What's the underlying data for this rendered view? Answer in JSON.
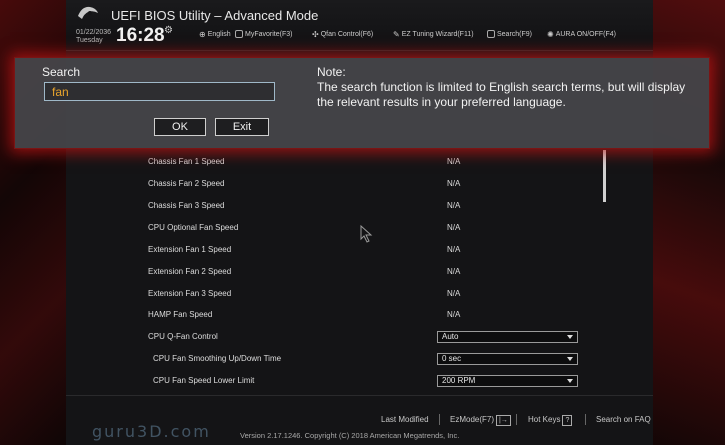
{
  "header": {
    "title": "UEFI BIOS Utility – Advanced Mode",
    "date": "01/22/2036",
    "day": "Tuesday",
    "time": "16:28",
    "items": [
      {
        "label": "English",
        "icon": "globe-icon"
      },
      {
        "label": "MyFavorite(F3)",
        "icon": "favorite-icon"
      },
      {
        "label": "Qfan Control(F6)",
        "icon": "fan-icon"
      },
      {
        "label": "EZ Tuning Wizard(F11)",
        "icon": "wizard-icon"
      },
      {
        "label": "Search(F9)",
        "icon": "help-icon"
      },
      {
        "label": "AURA ON/OFF(F4)",
        "icon": "aura-icon"
      }
    ]
  },
  "settings": [
    {
      "label": "Chassis Fan 1 Speed",
      "value": "N/A"
    },
    {
      "label": "Chassis Fan 2 Speed",
      "value": "N/A"
    },
    {
      "label": "Chassis Fan 3 Speed",
      "value": "N/A"
    },
    {
      "label": "CPU Optional Fan Speed",
      "value": "N/A"
    },
    {
      "label": "Extension Fan 1 Speed",
      "value": "N/A"
    },
    {
      "label": "Extension Fan 2 Speed",
      "value": "N/A"
    },
    {
      "label": "Extension Fan 3 Speed",
      "value": "N/A"
    },
    {
      "label": "HAMP Fan Speed",
      "value": "N/A"
    },
    {
      "label": "CPU Q-Fan Control",
      "select": "Auto"
    },
    {
      "label": "CPU Fan Smoothing Up/Down Time",
      "select": "0 sec"
    },
    {
      "label": "CPU Fan Speed Lower Limit",
      "select": "200 RPM"
    }
  ],
  "search_dialog": {
    "label": "Search",
    "query": "fan",
    "ok_label": "OK",
    "exit_label": "Exit",
    "note_title": "Note:",
    "note_text": "The search function is limited to English search terms, but will display the relevant results in your preferred language."
  },
  "footer": {
    "last_modified": "Last Modified",
    "ezmode": "EzMode(F7)",
    "ezmode_key": "|→",
    "hot_keys": "Hot Keys",
    "hot_keys_key": "?",
    "search_faq": "Search on FAQ",
    "version": "Version 2.17.1246. Copyright (C) 2018 American Megatrends, Inc.",
    "watermark": "guru3D.com"
  },
  "colors": {
    "accent_red": "#c81414",
    "search_text": "#e8a42c"
  }
}
